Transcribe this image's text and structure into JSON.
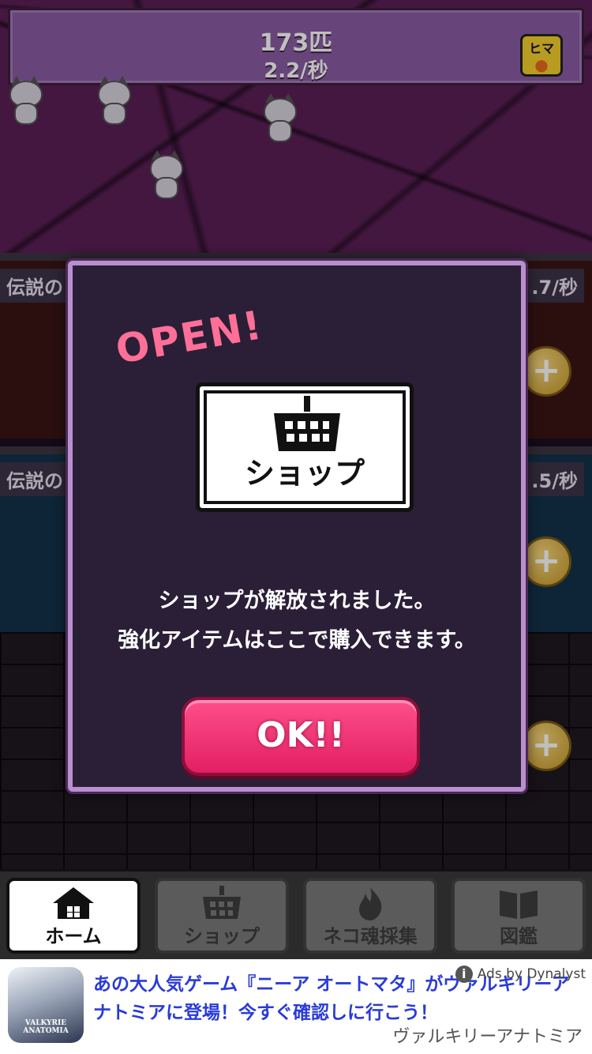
{
  "header": {
    "count": "173匹",
    "rate": "2.2/秒",
    "hima_label": "ヒマ"
  },
  "rows": [
    {
      "label": "伝説の",
      "rate": ".7/秒"
    },
    {
      "label": "伝説の",
      "rate": ".5/秒"
    }
  ],
  "dialog": {
    "badge": "OPEN!",
    "card_label": "ショップ",
    "message_line1": "ショップが解放されました。",
    "message_line2": "強化アイテムはここで購入できます。",
    "ok_label": "OK!!"
  },
  "nav": {
    "tabs": [
      {
        "label": "ホーム",
        "icon": "house-icon",
        "active": true
      },
      {
        "label": "ショップ",
        "icon": "basket-icon",
        "active": false
      },
      {
        "label": "ネコ魂採集",
        "icon": "flame-icon",
        "active": false
      },
      {
        "label": "図鑑",
        "icon": "book-icon",
        "active": false
      }
    ]
  },
  "ad": {
    "headline": "あの大人気ゲーム『ニーア オートマタ』がヴァルキリーアナトミアに登場！今すぐ確認しに行こう！",
    "badge": "Ads by Dynalyst",
    "advertiser": "ヴァルキリーアナトミア",
    "thumb_text": "VALKYRIE ANATOMIA"
  }
}
